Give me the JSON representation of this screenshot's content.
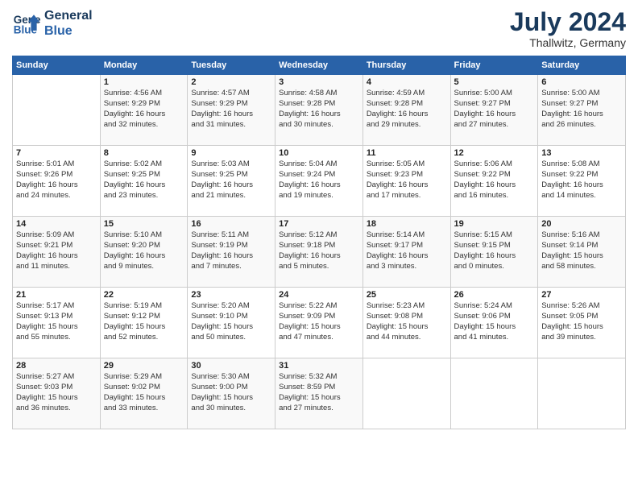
{
  "logo": {
    "line1": "General",
    "line2": "Blue"
  },
  "title": "July 2024",
  "location": "Thallwitz, Germany",
  "header_days": [
    "Sunday",
    "Monday",
    "Tuesday",
    "Wednesday",
    "Thursday",
    "Friday",
    "Saturday"
  ],
  "weeks": [
    [
      {
        "day": "",
        "info": ""
      },
      {
        "day": "1",
        "info": "Sunrise: 4:56 AM\nSunset: 9:29 PM\nDaylight: 16 hours\nand 32 minutes."
      },
      {
        "day": "2",
        "info": "Sunrise: 4:57 AM\nSunset: 9:29 PM\nDaylight: 16 hours\nand 31 minutes."
      },
      {
        "day": "3",
        "info": "Sunrise: 4:58 AM\nSunset: 9:28 PM\nDaylight: 16 hours\nand 30 minutes."
      },
      {
        "day": "4",
        "info": "Sunrise: 4:59 AM\nSunset: 9:28 PM\nDaylight: 16 hours\nand 29 minutes."
      },
      {
        "day": "5",
        "info": "Sunrise: 5:00 AM\nSunset: 9:27 PM\nDaylight: 16 hours\nand 27 minutes."
      },
      {
        "day": "6",
        "info": "Sunrise: 5:00 AM\nSunset: 9:27 PM\nDaylight: 16 hours\nand 26 minutes."
      }
    ],
    [
      {
        "day": "7",
        "info": "Sunrise: 5:01 AM\nSunset: 9:26 PM\nDaylight: 16 hours\nand 24 minutes."
      },
      {
        "day": "8",
        "info": "Sunrise: 5:02 AM\nSunset: 9:25 PM\nDaylight: 16 hours\nand 23 minutes."
      },
      {
        "day": "9",
        "info": "Sunrise: 5:03 AM\nSunset: 9:25 PM\nDaylight: 16 hours\nand 21 minutes."
      },
      {
        "day": "10",
        "info": "Sunrise: 5:04 AM\nSunset: 9:24 PM\nDaylight: 16 hours\nand 19 minutes."
      },
      {
        "day": "11",
        "info": "Sunrise: 5:05 AM\nSunset: 9:23 PM\nDaylight: 16 hours\nand 17 minutes."
      },
      {
        "day": "12",
        "info": "Sunrise: 5:06 AM\nSunset: 9:22 PM\nDaylight: 16 hours\nand 16 minutes."
      },
      {
        "day": "13",
        "info": "Sunrise: 5:08 AM\nSunset: 9:22 PM\nDaylight: 16 hours\nand 14 minutes."
      }
    ],
    [
      {
        "day": "14",
        "info": "Sunrise: 5:09 AM\nSunset: 9:21 PM\nDaylight: 16 hours\nand 11 minutes."
      },
      {
        "day": "15",
        "info": "Sunrise: 5:10 AM\nSunset: 9:20 PM\nDaylight: 16 hours\nand 9 minutes."
      },
      {
        "day": "16",
        "info": "Sunrise: 5:11 AM\nSunset: 9:19 PM\nDaylight: 16 hours\nand 7 minutes."
      },
      {
        "day": "17",
        "info": "Sunrise: 5:12 AM\nSunset: 9:18 PM\nDaylight: 16 hours\nand 5 minutes."
      },
      {
        "day": "18",
        "info": "Sunrise: 5:14 AM\nSunset: 9:17 PM\nDaylight: 16 hours\nand 3 minutes."
      },
      {
        "day": "19",
        "info": "Sunrise: 5:15 AM\nSunset: 9:15 PM\nDaylight: 16 hours\nand 0 minutes."
      },
      {
        "day": "20",
        "info": "Sunrise: 5:16 AM\nSunset: 9:14 PM\nDaylight: 15 hours\nand 58 minutes."
      }
    ],
    [
      {
        "day": "21",
        "info": "Sunrise: 5:17 AM\nSunset: 9:13 PM\nDaylight: 15 hours\nand 55 minutes."
      },
      {
        "day": "22",
        "info": "Sunrise: 5:19 AM\nSunset: 9:12 PM\nDaylight: 15 hours\nand 52 minutes."
      },
      {
        "day": "23",
        "info": "Sunrise: 5:20 AM\nSunset: 9:10 PM\nDaylight: 15 hours\nand 50 minutes."
      },
      {
        "day": "24",
        "info": "Sunrise: 5:22 AM\nSunset: 9:09 PM\nDaylight: 15 hours\nand 47 minutes."
      },
      {
        "day": "25",
        "info": "Sunrise: 5:23 AM\nSunset: 9:08 PM\nDaylight: 15 hours\nand 44 minutes."
      },
      {
        "day": "26",
        "info": "Sunrise: 5:24 AM\nSunset: 9:06 PM\nDaylight: 15 hours\nand 41 minutes."
      },
      {
        "day": "27",
        "info": "Sunrise: 5:26 AM\nSunset: 9:05 PM\nDaylight: 15 hours\nand 39 minutes."
      }
    ],
    [
      {
        "day": "28",
        "info": "Sunrise: 5:27 AM\nSunset: 9:03 PM\nDaylight: 15 hours\nand 36 minutes."
      },
      {
        "day": "29",
        "info": "Sunrise: 5:29 AM\nSunset: 9:02 PM\nDaylight: 15 hours\nand 33 minutes."
      },
      {
        "day": "30",
        "info": "Sunrise: 5:30 AM\nSunset: 9:00 PM\nDaylight: 15 hours\nand 30 minutes."
      },
      {
        "day": "31",
        "info": "Sunrise: 5:32 AM\nSunset: 8:59 PM\nDaylight: 15 hours\nand 27 minutes."
      },
      {
        "day": "",
        "info": ""
      },
      {
        "day": "",
        "info": ""
      },
      {
        "day": "",
        "info": ""
      }
    ]
  ]
}
